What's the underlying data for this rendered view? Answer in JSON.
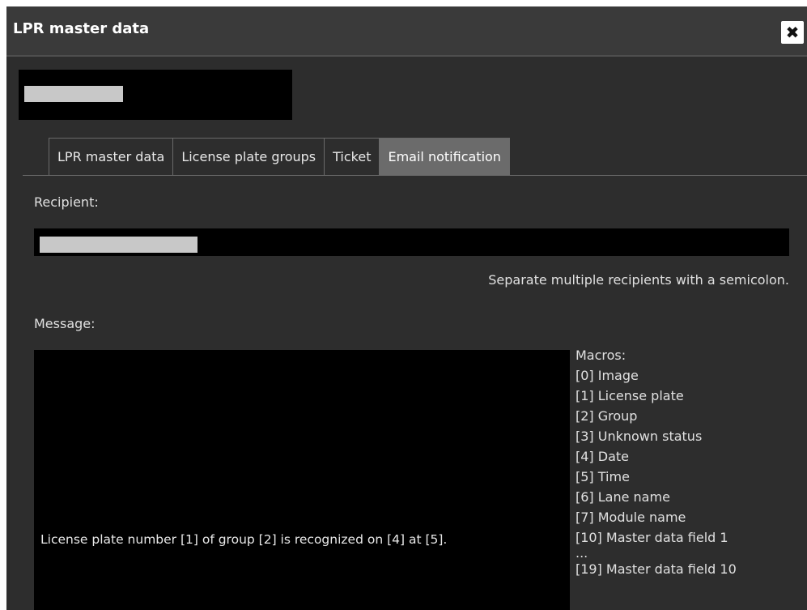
{
  "dialog": {
    "title": "LPR master data",
    "close_icon": "✖"
  },
  "tabs": [
    {
      "label": "LPR master data",
      "active": false
    },
    {
      "label": "License plate groups",
      "active": false
    },
    {
      "label": "Ticket",
      "active": false
    },
    {
      "label": "Email notification",
      "active": true
    }
  ],
  "recipient": {
    "label": "Recipient:",
    "hint": "Separate multiple recipients with a semicolon."
  },
  "message": {
    "label": "Message:",
    "value": "License plate number [1] of group [2] is recognized on [4] at [5]."
  },
  "macros": {
    "title": "Macros:",
    "items": [
      "[0] Image",
      "[1] License plate",
      "[2] Group",
      "[3] Unknown status",
      "[4] Date",
      "[5] Time",
      "[6] Lane name",
      "[7] Module name",
      "[10] Master data field 1",
      "...",
      "[19] Master data field 10"
    ]
  }
}
